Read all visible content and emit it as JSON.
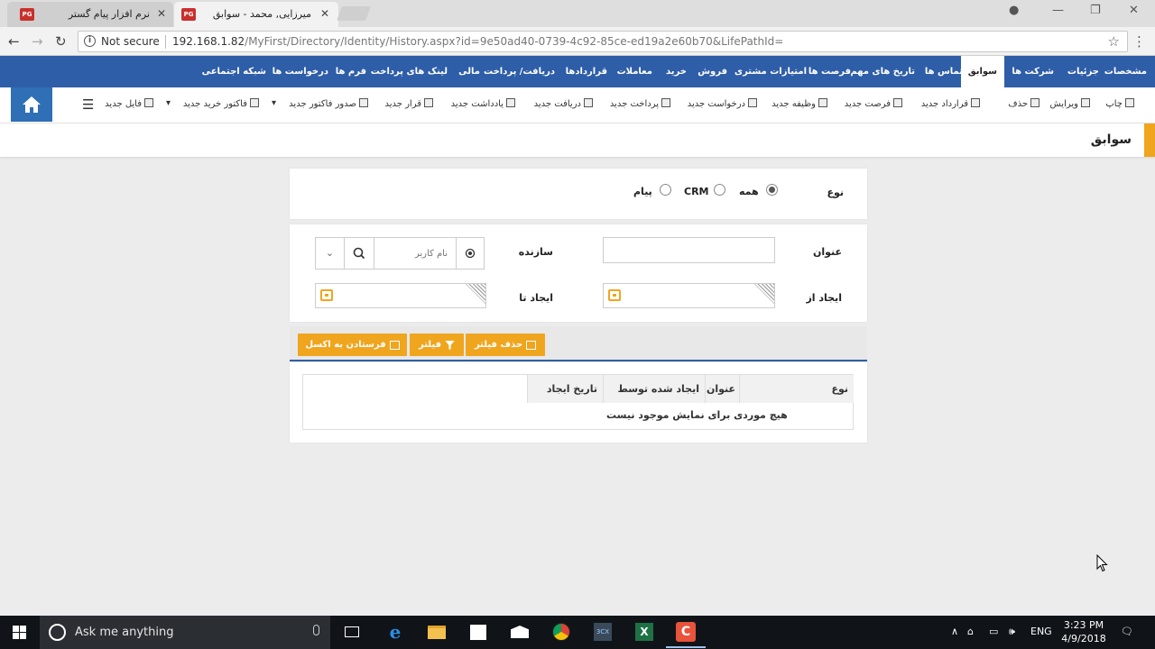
{
  "browser": {
    "tabs": [
      {
        "title": "نرم افزار پیام گستر",
        "favicon": "PG",
        "active": false
      },
      {
        "title": "میرزایی, محمد - سوابق",
        "favicon": "PG",
        "active": true
      }
    ],
    "address": {
      "security": "Not secure",
      "url_host": "192.168.1.82",
      "url_path": "/MyFirst/Directory/Identity/History.aspx?id=9e50ad40-0739-4c92-85ce-ed19a2e60b70&LifePathId="
    }
  },
  "topnav": {
    "items": [
      "مشخصات",
      "جزئیات",
      "شرکت ها",
      "سوابق",
      "تماس ها",
      "تاریخ های مهم",
      "فرصت ها",
      "امتیازات مشتری",
      "فروش",
      "خرید",
      "معاملات",
      "قراردادها",
      "دریافت/ پرداخت",
      "مالی",
      "لینک های پرداخت",
      "فرم ها",
      "درخواست ها",
      "شبکه اجتماعی"
    ],
    "active": "سوابق"
  },
  "toolbar": {
    "items": [
      "چاپ",
      "ویرایش",
      "حذف",
      "قرارداد جدید",
      "فرصت جدید",
      "وظیفه جدید",
      "درخواست جدید",
      "پرداخت جدید",
      "دریافت جدید",
      "یادداشت جدید",
      "قرار جدید",
      "صدور فاکتور جدید",
      "فاکتور خرید جدید",
      "فایل جدید"
    ]
  },
  "page": {
    "title": "سوابق"
  },
  "filter": {
    "type_label": "نوع",
    "type_options": [
      {
        "label": "همه",
        "selected": true
      },
      {
        "label": "CRM",
        "selected": false
      },
      {
        "label": "پیام",
        "selected": false
      }
    ],
    "title_label": "عنوان",
    "title_value": "",
    "creator_label": "سازنده",
    "creator_placeholder": "نام کاربر",
    "created_from_label": "ایجاد از",
    "created_to_label": "ایجاد تا"
  },
  "actions": {
    "clear_filter": "حذف فیلتر",
    "filter": "فیلتر",
    "export_excel": "فرستادن به اکسل"
  },
  "grid": {
    "columns": [
      "نوع",
      "عنوان",
      "ایجاد شده توسط",
      "تاریخ ایجاد"
    ],
    "empty_message": "هیچ موردی برای نمایش موجود نیست"
  },
  "taskbar": {
    "search_placeholder": "Ask me anything",
    "language": "ENG",
    "time": "3:23 PM",
    "date": "4/9/2018"
  },
  "colors": {
    "nav_blue": "#2f5ea8",
    "accent_orange": "#f0a51f",
    "home_blue": "#2f6fb5"
  }
}
